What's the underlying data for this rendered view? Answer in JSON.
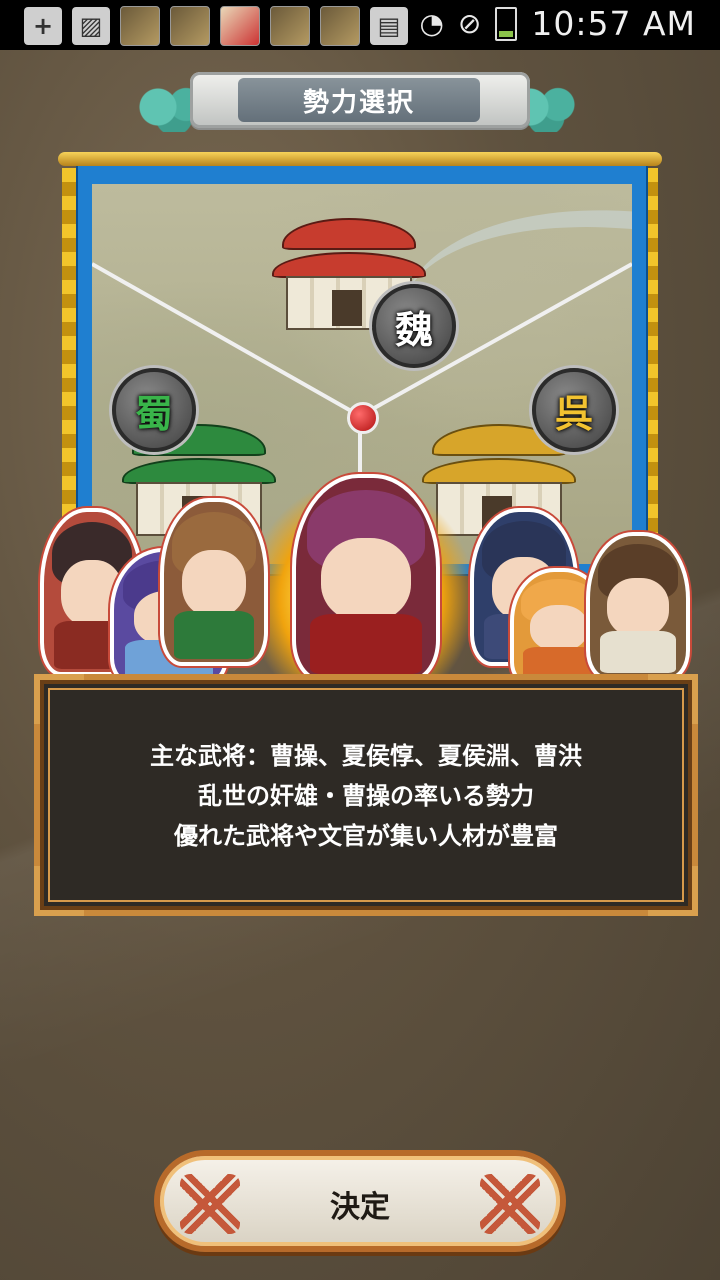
{
  "status_bar": {
    "time": "10:57 AM",
    "notification_icons": [
      "plus-icon",
      "image-icon",
      "app-icon",
      "app-icon",
      "app-icon",
      "app-icon",
      "app-icon",
      "sd-card-icon"
    ],
    "system_icons": [
      "wifi-icon",
      "no-disturb-icon",
      "battery-charging-icon"
    ]
  },
  "header": {
    "title": "勢力選択"
  },
  "map": {
    "factions": [
      {
        "label": "魏",
        "color": "#ffffff"
      },
      {
        "label": "蜀",
        "color": "#39b54a"
      },
      {
        "label": "呉",
        "color": "#f2c230"
      }
    ]
  },
  "description": {
    "line1": "主な武将：曹操、夏侯惇、夏侯淵、曹洪",
    "line2": "乱世の奸雄・曹操の率いる勢力",
    "line3": "優れた武将や文官が集い人材が豊富"
  },
  "confirm_button": {
    "label": "決定"
  },
  "colors": {
    "banner_blue": "#1f7fd0",
    "frame_gold": "#c9893b",
    "button_border": "#b76a2a"
  }
}
